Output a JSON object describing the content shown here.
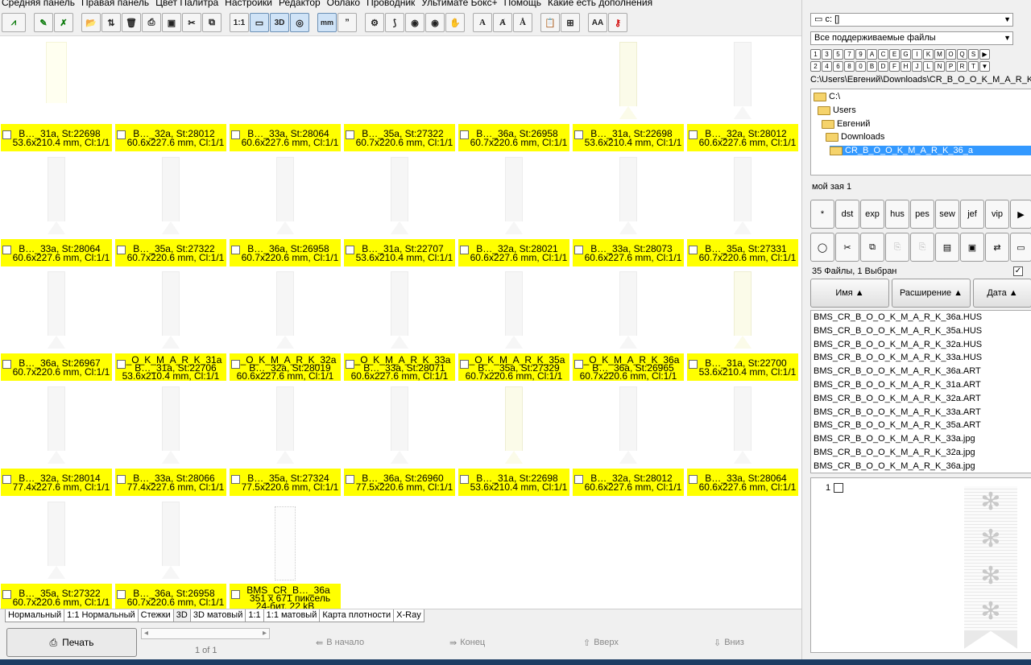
{
  "menu": [
    "Средняя панель",
    "Правая панель",
    "Цвет Палитра",
    "Настройки",
    "Редактор",
    "Облако",
    "Проводник",
    "Ультимате Бокс+",
    "Помощь",
    "Какие есть дополнения"
  ],
  "toolbar": {
    "btn_1to1": "1:1",
    "btn_3d": "3D",
    "btn_mm": "mm",
    "btn_font_a": "A",
    "btn_aa": "AA"
  },
  "thumbnails": [
    {
      "l1": "B…_31a, St:22698",
      "l2": "53.6x210.4 mm, Cl:1/1",
      "cls": "yellow",
      "w": 24,
      "h": 80
    },
    {
      "l1": "",
      "l2": "",
      "cls": "none",
      "w": 0,
      "h": 0,
      "hidecap": true,
      "yellow": true,
      "l1b": "B…_32a, St:28012",
      "l2b": "60.6x227.6 mm, Cl:1/1"
    },
    {
      "l1": "B…_33a, St:28064",
      "l2": "60.6x227.6 mm, Cl:1/1",
      "cls": "none"
    },
    {
      "l1": "B…_35a, St:27322",
      "l2": "60.7x220.6 mm, Cl:1/1",
      "cls": "none"
    },
    {
      "l1": "B…_36a, St:26958",
      "l2": "60.7x220.6 mm, Cl:1/1",
      "cls": "none"
    },
    {
      "l1": "B…_31a, St:22698",
      "l2": "53.6x210.4 mm, Cl:1/1",
      "cls": "t31"
    },
    {
      "l1": "B…_32a, St:28012",
      "l2": "60.6x227.6 mm, Cl:1/1",
      "cls": ""
    }
  ],
  "rows": [
    [
      {
        "l1": "B…_31a, St:22698",
        "l2": "53.6x210.4 mm, Cl:1/1",
        "cls": "yellow"
      },
      {
        "l1": "B…_32a, St:28012",
        "l2": "60.6x227.6 mm, Cl:1/1",
        "cls": "none"
      },
      {
        "l1": "B…_33a, St:28064",
        "l2": "60.6x227.6 mm, Cl:1/1",
        "cls": "none"
      },
      {
        "l1": "B…_35a, St:27322",
        "l2": "60.7x220.6 mm, Cl:1/1",
        "cls": "none"
      },
      {
        "l1": "B…_36a, St:26958",
        "l2": "60.7x220.6 mm, Cl:1/1",
        "cls": "none"
      },
      {
        "l1": "B…_31a, St:22698",
        "l2": "53.6x210.4 mm, Cl:1/1",
        "cls": "t31"
      },
      {
        "l1": "B…_32a, St:28012",
        "l2": "60.6x227.6 mm, Cl:1/1",
        "cls": ""
      }
    ],
    [
      {
        "l1": "B…_33a, St:28064",
        "l2": "60.6x227.6 mm, Cl:1/1",
        "cls": ""
      },
      {
        "l1": "B…_35a, St:27322",
        "l2": "60.7x220.6 mm, Cl:1/1",
        "cls": ""
      },
      {
        "l1": "B…_36a, St:26958",
        "l2": "60.7x220.6 mm, Cl:1/1",
        "cls": ""
      },
      {
        "l1": "B…_31a, St:22707",
        "l2": "53.6x210.4 mm, Cl:1/1",
        "cls": ""
      },
      {
        "l1": "B…_32a, St:28021",
        "l2": "60.6x227.6 mm, Cl:1/1",
        "cls": ""
      },
      {
        "l1": "B…_33a, St:28073",
        "l2": "60.6x227.6 mm, Cl:1/1",
        "cls": ""
      },
      {
        "l1": "B…_35a, St:27331",
        "l2": "60.7x220.6 mm, Cl:1/1",
        "cls": ""
      }
    ],
    [
      {
        "l1": "B…_36a, St:26967",
        "l2": "60.7x220.6 mm, Cl:1/1",
        "cls": ""
      },
      {
        "l1": "_O_K_M_A_R_K_31a",
        "l2": "B…_31a, St:22706",
        "l3": "53.6x210.4 mm, Cl:1/1",
        "cls": "",
        "multi": true
      },
      {
        "l1": "_O_K_M_A_R_K_32a",
        "l2": "B…_32a, St:28019",
        "l3": "60.6x227.6 mm, Cl:1/1",
        "cls": "",
        "multi": true
      },
      {
        "l1": "_O_K_M_A_R_K_33a",
        "l2": "B…_33a, St:28071",
        "l3": "60.6x227.6 mm, Cl:1/1",
        "cls": "",
        "multi": true
      },
      {
        "l1": "_O_K_M_A_R_K_35a",
        "l2": "B…_35a, St:27329",
        "l3": "60.7x220.6 mm, Cl:1/1",
        "cls": "",
        "multi": true
      },
      {
        "l1": "_O_K_M_A_R_K_36a",
        "l2": "B…_36a, St:26965",
        "l3": "60.7x220.6 mm, Cl:1/1",
        "cls": "",
        "multi": true
      },
      {
        "l1": "B…_31a, St:22700",
        "l2": "53.6x210.4 mm, Cl:1/1",
        "cls": "t31"
      }
    ],
    [
      {
        "l1": "B…_32a, St:28014",
        "l2": "77.4x227.6 mm, Cl:1/1",
        "cls": ""
      },
      {
        "l1": "B…_33a, St:28066",
        "l2": "77.4x227.6 mm, Cl:1/1",
        "cls": ""
      },
      {
        "l1": "B…_35a, St:27324",
        "l2": "77.5x220.6 mm, Cl:1/1",
        "cls": ""
      },
      {
        "l1": "B…_36a, St:26960",
        "l2": "77.5x220.6 mm, Cl:1/1",
        "cls": ""
      },
      {
        "l1": "B…_31a, St:22698",
        "l2": "53.6x210.4 mm, Cl:1/1",
        "cls": "t31"
      },
      {
        "l1": "B…_32a, St:28012",
        "l2": "60.6x227.6 mm, Cl:1/1",
        "cls": ""
      },
      {
        "l1": "B…_33a, St:28064",
        "l2": "60.6x227.6 mm, Cl:1/1",
        "cls": ""
      }
    ],
    [
      {
        "l1": "B…_35a, St:27322",
        "l2": "60.7x220.6 mm, Cl:1/1",
        "cls": ""
      },
      {
        "l1": "B…_36a, St:26958",
        "l2": "60.7x220.6 mm, Cl:1/1",
        "cls": ""
      },
      {
        "l1": "BMS_CR_B…_36a",
        "l2": "351 x 671 пиксель",
        "l3": "24-бит, 22 kB",
        "cls": "bmp",
        "multi": true
      }
    ]
  ],
  "view_tabs": [
    "Нормальный",
    "1:1 Нормальный",
    "Стежки",
    "3D",
    "3D матовый",
    "1:1",
    "1:1 матовый",
    "Карта плотности",
    "X-Ray"
  ],
  "bottom": {
    "print": "Печать",
    "page_info": "1 of 1",
    "to_start": "В начало",
    "to_end": "Конец",
    "up": "Вверх",
    "down": "Вниз"
  },
  "right": {
    "drive": "c: []",
    "filter": "Все поддерживаемые файлы",
    "keys_row1": [
      "1",
      "3",
      "5",
      "7",
      "9",
      "A",
      "C",
      "E",
      "G",
      "I",
      "K",
      "M",
      "O",
      "Q",
      "S",
      "▶"
    ],
    "keys_row2": [
      "2",
      "4",
      "6",
      "8",
      "0",
      "B",
      "D",
      "F",
      "H",
      "J",
      "L",
      "N",
      "P",
      "R",
      "T",
      "▼"
    ],
    "path": "C:\\Users\\Евгений\\Downloads\\CR_B_O_O_K_M_A_R_K_",
    "tree": [
      "C:\\",
      "Users",
      "Евгений",
      "Downloads",
      "CR_B_O_O_K_M_A_R_K_36_a"
    ],
    "collection": "мой зая 1",
    "filters": [
      "*",
      "dst",
      "exp",
      "hus",
      "pes",
      "sew",
      "jef",
      "vip",
      "▶"
    ],
    "count": "35 Файлы, 1 Выбран",
    "headers": {
      "name": "Имя ▲",
      "ext": "Расширение ▲",
      "date": "Дата ▲"
    },
    "files": [
      "BMS_CR_B_O_O_K_M_A_R_K_36a.HUS",
      "BMS_CR_B_O_O_K_M_A_R_K_35a.HUS",
      "BMS_CR_B_O_O_K_M_A_R_K_32a.HUS",
      "BMS_CR_B_O_O_K_M_A_R_K_33a.HUS",
      "BMS_CR_B_O_O_K_M_A_R_K_36a.ART",
      "BMS_CR_B_O_O_K_M_A_R_K_31a.ART",
      "BMS_CR_B_O_O_K_M_A_R_K_32a.ART",
      "BMS_CR_B_O_O_K_M_A_R_K_33a.ART",
      "BMS_CR_B_O_O_K_M_A_R_K_35a.ART",
      "BMS_CR_B_O_O_K_M_A_R_K_33a.jpg",
      "BMS_CR_B_O_O_K_M_A_R_K_32a.jpg",
      "BMS_CR_B_O_O_K_M_A_R_K_36a.jpg"
    ],
    "preview_num": "1"
  }
}
